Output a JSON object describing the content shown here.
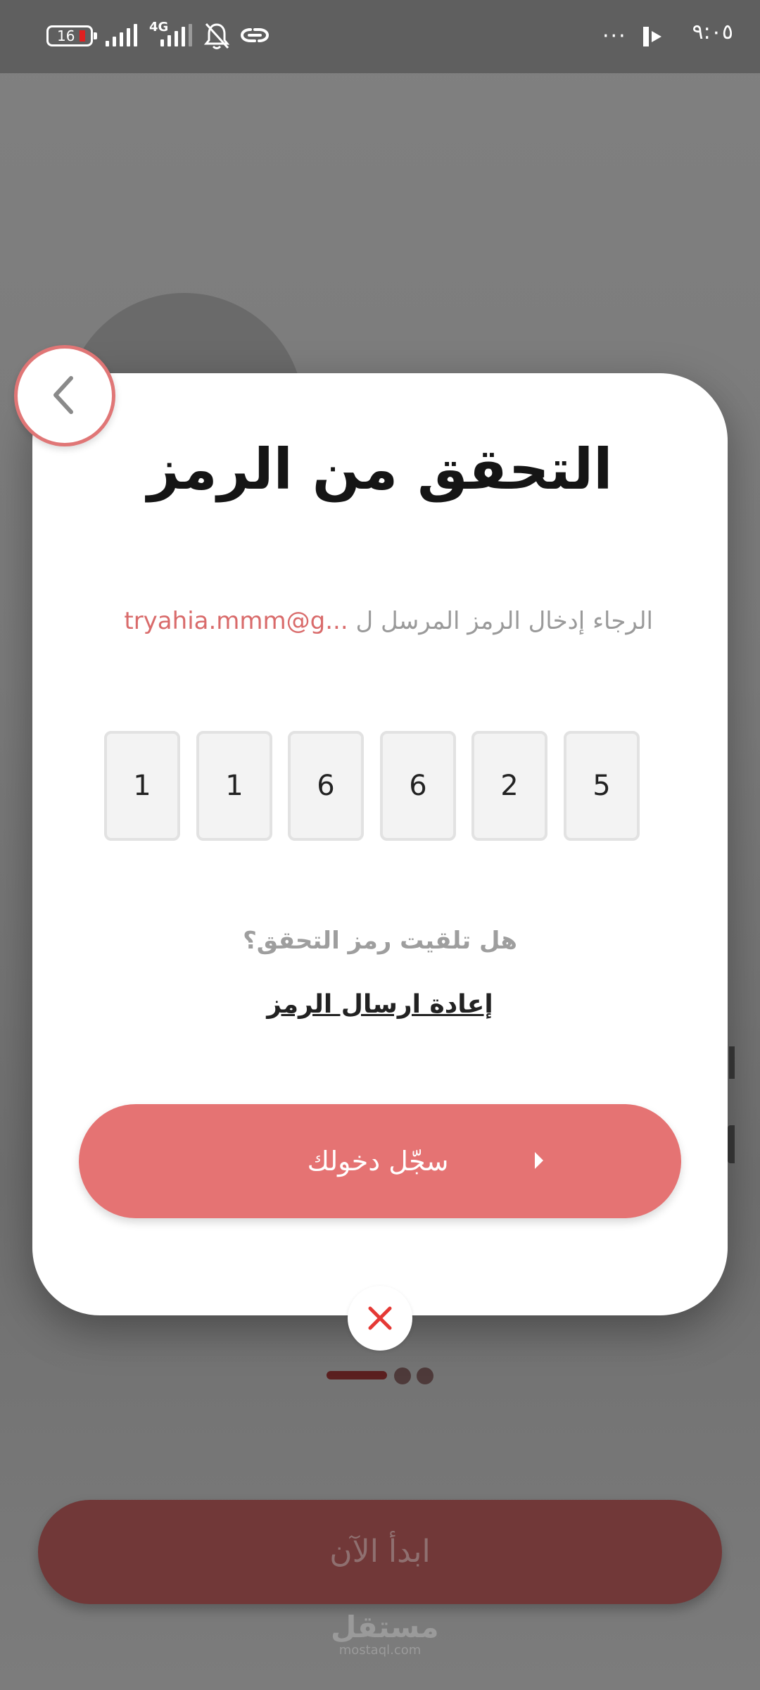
{
  "status_bar": {
    "battery": "16",
    "network": "4G",
    "time": "٩:٠٥",
    "more": "···"
  },
  "modal": {
    "title": "التحقق من الرمز",
    "instruction": "الرجاء إدخال الرمز المرسل ل",
    "email": "tryahia.mmm@g...",
    "code_digits": [
      "1",
      "1",
      "6",
      "6",
      "2",
      "5"
    ],
    "question": "هل تلقيت رمز التحقق؟",
    "resend_label": "إعادة ارسال الرمز",
    "login_label": "سجّل دخولك"
  },
  "background": {
    "start_label": "ابدأ الآن",
    "watermark": "مستقل",
    "watermark_domain": "mostaql.com"
  },
  "colors": {
    "accent": "#e57373",
    "accent_border": "#e07676",
    "close_x": "#e53935",
    "dim_button": "#713838"
  },
  "icons": [
    "back-chevron-icon",
    "close-icon",
    "signal-icon",
    "bell-off-icon",
    "link-icon",
    "arrow-right-icon"
  ]
}
